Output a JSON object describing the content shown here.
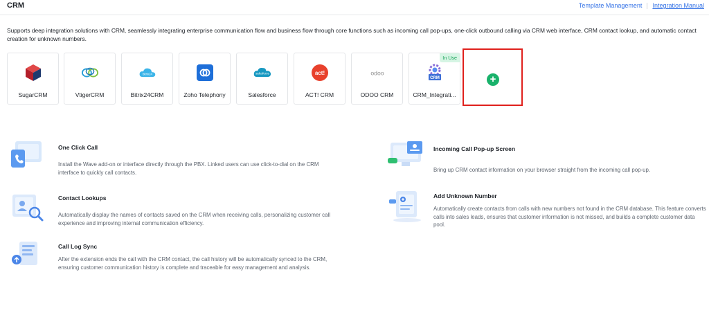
{
  "header": {
    "title": "CRM",
    "template_management": "Template Management",
    "integration_manual": "Integration Manual"
  },
  "description": "Supports deep integration solutions with CRM, seamlessly integrating enterprise communication flow and business flow through core functions such as incoming call pop-ups, one-click outbound calling via CRM web interface, CRM contact lookup, and automatic contact creation for unknown numbers.",
  "crm_cards": [
    {
      "name": "SugarCRM",
      "icon": "sugarcrm-cube-icon"
    },
    {
      "name": "VtigerCRM",
      "icon": "vtiger-rings-icon"
    },
    {
      "name": "Bitrix24CRM",
      "icon": "bitrix24-cloud-icon"
    },
    {
      "name": "Zoho Telephony",
      "icon": "zoho-link-icon"
    },
    {
      "name": "Salesforce",
      "icon": "salesforce-cloud-icon"
    },
    {
      "name": "ACT! CRM",
      "icon": "act-logo-icon",
      "logo_text": "act!"
    },
    {
      "name": "ODOO CRM",
      "icon": "odoo-logo-icon",
      "logo_text": "odoo"
    },
    {
      "name": "CRM_Integrati...",
      "icon": "crm-gear-icon",
      "logo_text": "CRM",
      "badge": "In Use"
    }
  ],
  "add_card": {
    "label": "+",
    "icon": "plus-circle-icon"
  },
  "features": {
    "one_click_call": {
      "title": "One Click Call",
      "desc": "Install the Wave add-on or interface directly through the PBX. Linked users can use click-to-dial on the CRM interface to quickly call contacts."
    },
    "contact_lookups": {
      "title": "Contact Lookups",
      "desc": "Automatically display the names of contacts saved on the CRM when receiving calls, personalizing customer call experience and improving internal communication efficiency."
    },
    "call_log_sync": {
      "title": "Call Log Sync",
      "desc": "After the extension ends the call with the CRM contact, the call history will be automatically synced to the CRM, ensuring customer communication history is complete and traceable for easy management and analysis."
    },
    "incoming_popup": {
      "title": "Incoming Call Pop-up Screen",
      "desc": "Bring up CRM contact information on your browser straight from the incoming call pop-up."
    },
    "add_unknown": {
      "title": "Add Unknown Number",
      "desc": "Automatically create contacts from calls with new numbers not found in the CRM database. This feature converts calls into sales leads, ensures that customer information is not missed, and builds a complete customer data pool."
    }
  },
  "colors": {
    "link": "#3573e6",
    "add_highlight": "#e0201c",
    "add_plus": "#19b26b",
    "badge_bg": "#d6f5e4",
    "badge_text": "#1ba35a"
  }
}
